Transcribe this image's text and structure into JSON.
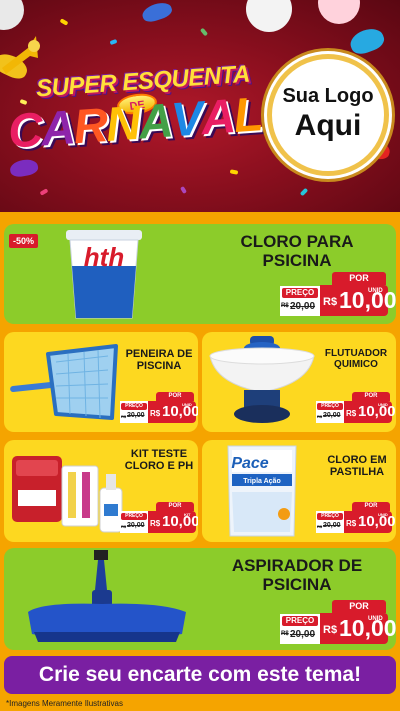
{
  "header": {
    "title_top": "SUPER ESQUENTA",
    "title_de": "DE",
    "title_main": "CARNAVAL",
    "logo_line1": "Sua Logo",
    "logo_line2": "Aqui"
  },
  "products": [
    {
      "name": "CLORO PARA PSICINA",
      "discount": "-50%",
      "por": "POR",
      "preco": "PREÇO",
      "old_prefix": "R$",
      "old_price": "20,00",
      "currency": "R$",
      "price": "10,00",
      "unit": "UNID",
      "icon": "hth-chlorine-bucket"
    },
    {
      "name": "PENEIRA DE PISCINA",
      "por": "POR",
      "preco": "PREÇO",
      "old_prefix": "R$",
      "old_price": "20,00",
      "currency": "R$",
      "price": "10,00",
      "unit": "UNID",
      "icon": "pool-skimmer-net"
    },
    {
      "name": "FLUTUADOR QUIMICO",
      "por": "POR",
      "preco": "PREÇO",
      "old_prefix": "R$",
      "old_price": "20,00",
      "currency": "R$",
      "price": "10,00",
      "unit": "UNID",
      "icon": "chemical-floater"
    },
    {
      "name": "KIT TESTE CLORO E PH",
      "por": "POR",
      "preco": "PREÇO",
      "old_prefix": "R$",
      "old_price": "20,00",
      "currency": "R$",
      "price": "10,00",
      "unit": "KIT",
      "icon": "test-kit"
    },
    {
      "name": "CLORO EM PASTILHA",
      "por": "POR",
      "preco": "PREÇO",
      "old_prefix": "R$",
      "old_price": "20,00",
      "currency": "R$",
      "price": "10,00",
      "unit": "UNID",
      "icon": "chlorine-tablet-bag"
    },
    {
      "name": "ASPIRADOR DE PSICINA",
      "por": "POR",
      "preco": "PREÇO",
      "old_prefix": "R$",
      "old_price": "20,00",
      "currency": "R$",
      "price": "10,00",
      "unit": "UNID",
      "icon": "pool-vacuum-head"
    }
  ],
  "product_art": {
    "bucket_brand": "hth",
    "bag_brand": "Pace",
    "bag_text": "Tripla Ação"
  },
  "footer": {
    "cta": "Crie seu encarte com este tema!",
    "disclaimer": "*Imagens Meramente Ilustrativas"
  },
  "colors": {
    "background": "#f5a400",
    "header": "#8a0f1e",
    "card_green": "#8ccc2a",
    "card_yellow": "#fdd820",
    "price_red": "#d81b2b",
    "cta_purple": "#7a1fa2"
  }
}
